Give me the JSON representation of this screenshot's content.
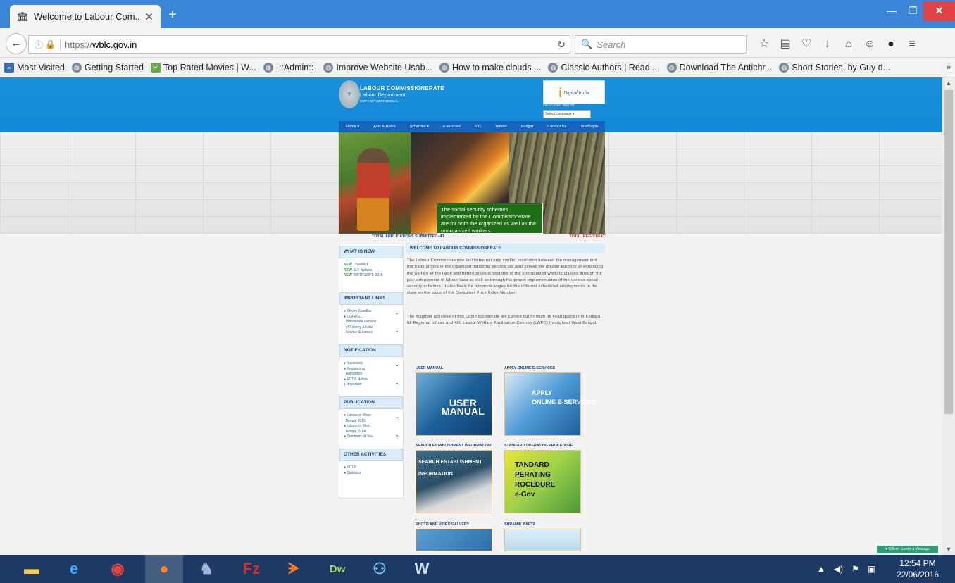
{
  "browser": {
    "tab_title": "Welcome to Labour Com...",
    "url_prefix": "https://",
    "url_domain": "wblc.gov.in",
    "search_placeholder": "Search",
    "bookmarks": [
      {
        "label": "Most Visited",
        "icon": "folder-icon"
      },
      {
        "label": "Getting Started",
        "icon": "globe-icon"
      },
      {
        "label": "Top Rated Movies | W...",
        "icon": "movie-icon"
      },
      {
        "label": "-::Admin::-",
        "icon": "globe-icon"
      },
      {
        "label": "Improve Website Usab...",
        "icon": "globe-icon"
      },
      {
        "label": "How to make clouds ...",
        "icon": "globe-icon"
      },
      {
        "label": "Classic Authors | Read ...",
        "icon": "globe-icon"
      },
      {
        "label": "Download The Antichr...",
        "icon": "globe-icon"
      },
      {
        "label": "Short Stories, by Guy d...",
        "icon": "globe-icon"
      }
    ],
    "bookmarks_more": "»"
  },
  "site": {
    "brand_line1": "LABOUR COMMISSIONERATE",
    "brand_line2": "Labour Department",
    "brand_line3": "GOVT. OF WEST BENGAL",
    "digital_india": "Digital India",
    "site_link": "Site Counter: 0851531",
    "language_label": "Select Language",
    "menu": [
      "Home ▾",
      "Acts & Rules",
      "Schemes ▾",
      "e-services",
      "RTI",
      "Tender",
      "Budget",
      "Contact Us",
      "Staff login"
    ],
    "hero_text": "The social security schemes implemented by the Commissionerate are for both the organized as well as the unorganized workers.",
    "ticker_left": "TOTAL APPLICATIONS SUBMITTED- 41",
    "ticker_right": "TOTAL REGISTRAT",
    "sidebar": {
      "whats_new_title": "WHAT IS NEW",
      "whats_new": [
        "Checklist",
        "SLT Notices",
        "WBTPSWPS-2015"
      ],
      "important_links_title": "IMPORTANT LINKS",
      "important_links": [
        "Shram Suvidha",
        "DGFASLI,",
        "Directorate General",
        "of Factory Advice",
        "Service & Labour"
      ],
      "notification_title": "NOTIFICATION",
      "notifications": [
        "Inspectors",
        "Registering",
        "Authorities",
        "ECDS Notice",
        "Important"
      ],
      "publication_title": "PUBLICATION",
      "publications": [
        "Labour in West",
        "Bengal 2015",
        "Labour in West",
        "Bengal 2014",
        "Summary of Tea"
      ],
      "other_title": "OTHER ACTIVITIES",
      "other": [
        "NCLP",
        "Statistics"
      ]
    },
    "welcome_title": "WELCOME TO LABOUR COMMISSIONERATE",
    "welcome_para1": "The Labour Commissionerate facilitates not only conflict resolution between the management and the trade unions in the organized industrial sectors but also serves the greater purpose of enhancing the welfare of the large and heterogeneous sections of the unorganized working classes through the just enforcement of labour laws as well as through the proper implementation of the various social security schemes. It also fixes the minimum wages for the different scheduled employments in the state on the basis of the Consumer Price Index Number.",
    "welcome_para2": "The manifold activities of this Commissionerate are carried out through its head quarters in Kolkata, 68 Regional offices and 480 Labour Welfare Facilitation Centres (LWFC) throughout West Bengal.",
    "tiles": [
      {
        "caption": "USER MANUAL"
      },
      {
        "caption": "APPLY ONLINE E-SERVICES"
      },
      {
        "caption": "SEARCH ESTABLISHMENT INFORMATION"
      },
      {
        "caption": "STANDARD OPERATING PROCEDURE"
      },
      {
        "caption": "PHOTO AND VIDEO GALLERY"
      },
      {
        "caption": "SHRAMIK BARTA"
      }
    ],
    "live_chat": "Offline - Leave a Message"
  },
  "taskbar": {
    "time": "12:54 PM",
    "date": "22/06/2016"
  }
}
